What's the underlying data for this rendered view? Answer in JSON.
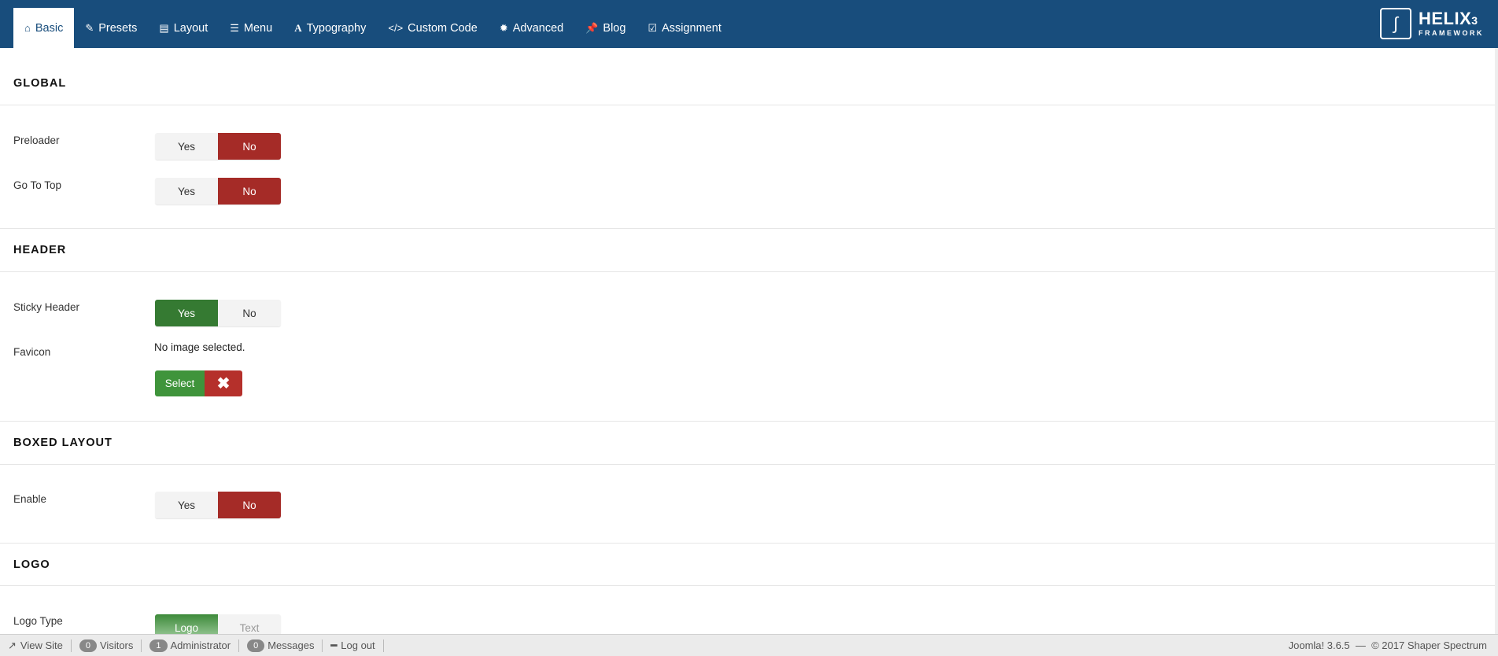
{
  "nav": {
    "tabs": [
      {
        "label": "Basic",
        "icon": "home-icon",
        "glyph": "⌂"
      },
      {
        "label": "Presets",
        "icon": "brush-icon",
        "glyph": "✎"
      },
      {
        "label": "Layout",
        "icon": "layout-icon",
        "glyph": "▤"
      },
      {
        "label": "Menu",
        "icon": "list-icon",
        "glyph": "☰"
      },
      {
        "label": "Typography",
        "icon": "font-icon",
        "glyph": "A"
      },
      {
        "label": "Custom Code",
        "icon": "code-icon",
        "glyph": "</>"
      },
      {
        "label": "Advanced",
        "icon": "gear-icon",
        "glyph": "✹"
      },
      {
        "label": "Blog",
        "icon": "pin-icon",
        "glyph": "📌"
      },
      {
        "label": "Assignment",
        "icon": "check-square-icon",
        "glyph": "☑"
      }
    ],
    "logo": {
      "title": "HELIX",
      "version": "3",
      "subtitle": "FRAMEWORK"
    }
  },
  "sections": {
    "global": "GLOBAL",
    "header": "HEADER",
    "boxed": "BOXED LAYOUT",
    "logo": "LOGO"
  },
  "fields": {
    "preloader": {
      "label": "Preloader",
      "yes": "Yes",
      "no": "No",
      "value": "No"
    },
    "gototop": {
      "label": "Go To Top",
      "yes": "Yes",
      "no": "No",
      "value": "No"
    },
    "sticky": {
      "label": "Sticky Header",
      "yes": "Yes",
      "no": "No",
      "value": "Yes"
    },
    "favicon": {
      "label": "Favicon",
      "status": "No image selected.",
      "select": "Select",
      "clear": "✖"
    },
    "boxed": {
      "label": "Enable",
      "yes": "Yes",
      "no": "No",
      "value": "No"
    },
    "logotype": {
      "label": "Logo Type",
      "opt1": "Logo",
      "opt2": "Text",
      "value": "Logo"
    }
  },
  "footer": {
    "view_site": "View Site",
    "visitors_count": "0",
    "visitors": "Visitors",
    "admin_count": "1",
    "admin": "Administrator",
    "messages_count": "0",
    "messages": "Messages",
    "logout": "Log out",
    "right": "Joomla! 3.6.5  —  © 2017 Shaper Spectrum"
  }
}
